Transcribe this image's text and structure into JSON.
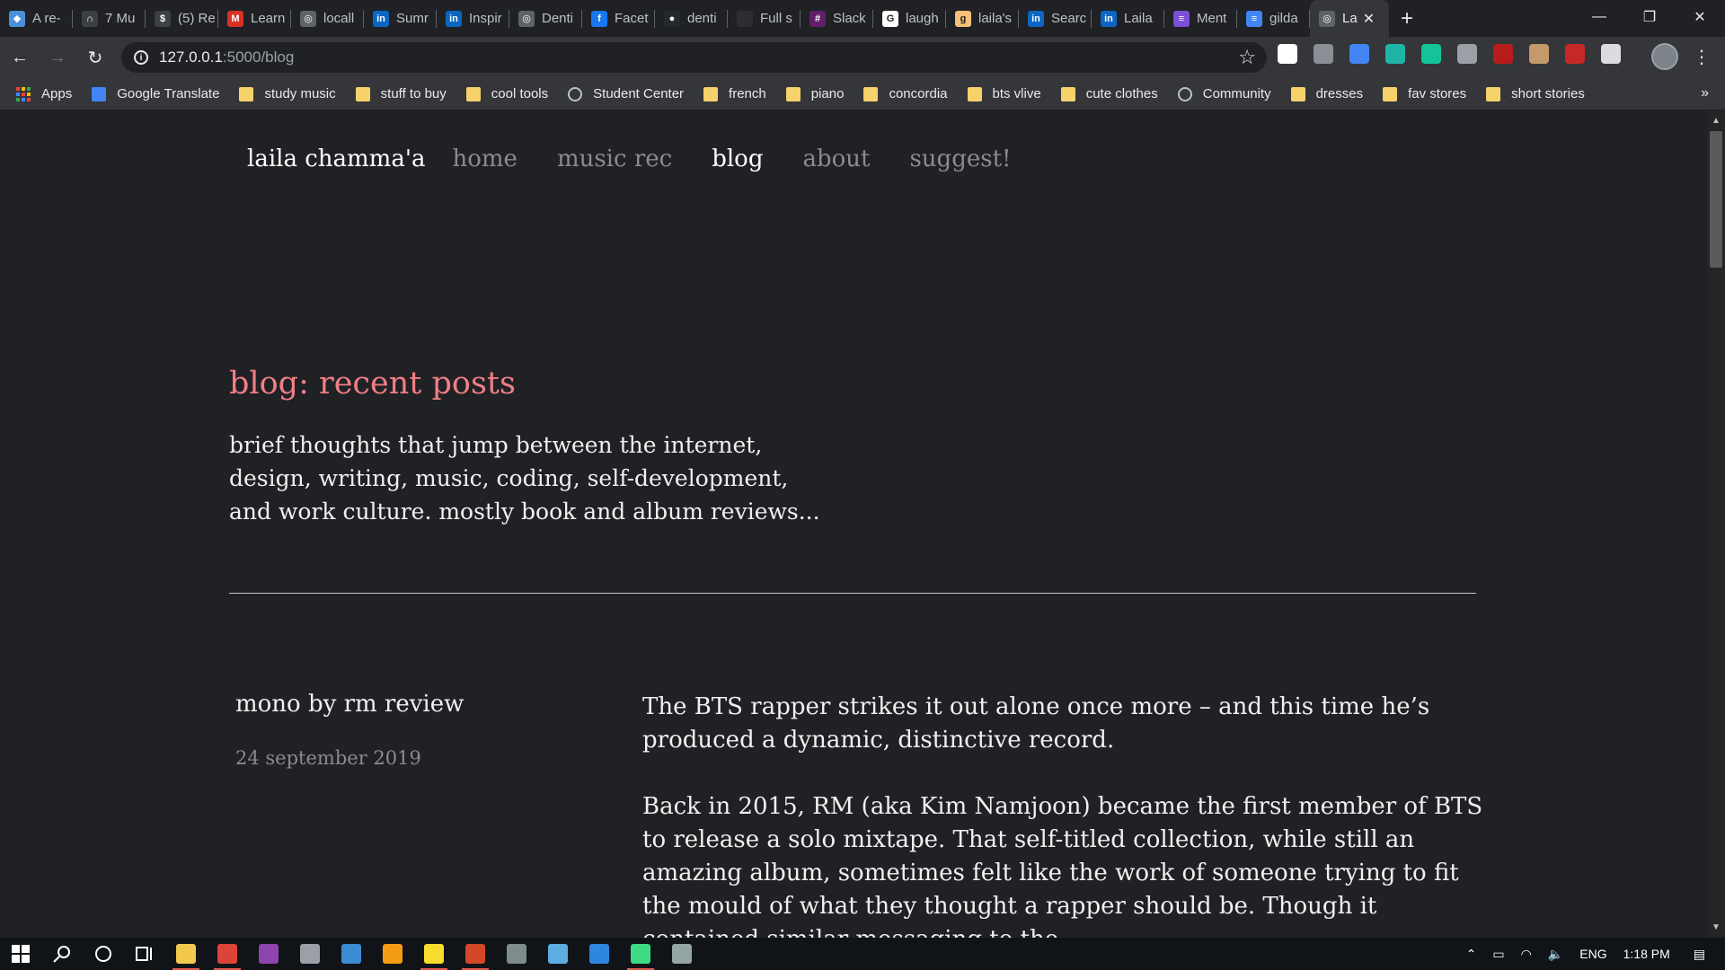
{
  "browser": {
    "tabs": [
      {
        "label": "A re-",
        "fav_color": "#4a90d9",
        "fav_glyph": "◆"
      },
      {
        "label": "7 Mu",
        "fav_color": "#3c4043",
        "fav_glyph": "∩"
      },
      {
        "label": "(5) Re",
        "fav_color": "#3c4043",
        "fav_glyph": "$"
      },
      {
        "label": "Learn",
        "fav_color": "#d93025",
        "fav_glyph": "M"
      },
      {
        "label": "locall",
        "fav_color": "#5f6368",
        "fav_glyph": "◎"
      },
      {
        "label": "Sumr",
        "fav_color": "#0a66c2",
        "fav_glyph": "in"
      },
      {
        "label": "Inspir",
        "fav_color": "#0a66c2",
        "fav_glyph": "in"
      },
      {
        "label": "Denti",
        "fav_color": "#5f6368",
        "fav_glyph": "◎"
      },
      {
        "label": "Facet",
        "fav_color": "#1877f2",
        "fav_glyph": "f"
      },
      {
        "label": "denti",
        "fav_color": "#24292e",
        "fav_glyph": "●"
      },
      {
        "label": "Full s",
        "fav_color": "#2d2e30",
        "fav_glyph": ""
      },
      {
        "label": "Slack",
        "fav_color": "#611f69",
        "fav_glyph": "#"
      },
      {
        "label": "laugh",
        "fav_color": "#ffffff",
        "fav_glyph": "G"
      },
      {
        "label": "laila's",
        "fav_color": "#f6c177",
        "fav_glyph": "g"
      },
      {
        "label": "Searc",
        "fav_color": "#0a66c2",
        "fav_glyph": "in"
      },
      {
        "label": "Laila",
        "fav_color": "#0a66c2",
        "fav_glyph": "in"
      },
      {
        "label": "Ment",
        "fav_color": "#7b4fd6",
        "fav_glyph": "≡"
      },
      {
        "label": "gilda",
        "fav_color": "#4285f4",
        "fav_glyph": "≡"
      }
    ],
    "active_tab": {
      "label": "La",
      "fav_color": "#5f6368",
      "fav_glyph": "◎"
    },
    "url_host": "127.0.0.1",
    "url_path": ":5000/blog",
    "extensions": [
      {
        "name": "block-extension-icon",
        "color": "#ffffff"
      },
      {
        "name": "nx-extension-icon",
        "color": "#8a8f96"
      },
      {
        "name": "translate-extension-icon",
        "color": "#4285f4"
      },
      {
        "name": "m-extension-icon",
        "color": "#1fb5a6"
      },
      {
        "name": "grammarly-extension-icon",
        "color": "#15c39a"
      },
      {
        "name": "puzzle-extension-icon",
        "color": "#9aa0a6"
      },
      {
        "name": "ublock-extension-icon",
        "color": "#b71c1c"
      },
      {
        "name": "gear-extension-icon",
        "color": "#c49a6c"
      },
      {
        "name": "flag-extension-icon",
        "color": "#c62828"
      },
      {
        "name": "circle-extension-icon",
        "color": "#dadce0"
      }
    ],
    "bookmarks": [
      {
        "label": "Apps",
        "type": "apps"
      },
      {
        "label": "Google Translate",
        "type": "translate"
      },
      {
        "label": "study music",
        "type": "folder"
      },
      {
        "label": "stuff to buy",
        "type": "folder"
      },
      {
        "label": "cool tools",
        "type": "folder"
      },
      {
        "label": "Student Center",
        "type": "globe"
      },
      {
        "label": "french",
        "type": "folder"
      },
      {
        "label": "piano",
        "type": "folder"
      },
      {
        "label": "concordia",
        "type": "folder"
      },
      {
        "label": "bts vlive",
        "type": "folder"
      },
      {
        "label": "cute clothes",
        "type": "folder"
      },
      {
        "label": "Community",
        "type": "globe"
      },
      {
        "label": "dresses",
        "type": "folder"
      },
      {
        "label": "fav stores",
        "type": "folder"
      },
      {
        "label": "short stories",
        "type": "folder"
      }
    ],
    "bookmarks_overflow": "»"
  },
  "site": {
    "brand": "laila chamma'a",
    "nav": [
      "home",
      "music rec",
      "blog",
      "about",
      "suggest!"
    ],
    "current_nav": "blog",
    "heading": "blog: recent posts",
    "intro": "brief thoughts that jump between the internet, design, writing, music, coding, self-development, and work culture. mostly book and album reviews...",
    "post": {
      "title": "mono by rm review",
      "date": "24 september 2019",
      "paragraphs": [
        "The BTS rapper strikes it out alone once more – and this time he’s produced a dynamic, distinctive record.",
        "Back in 2015, RM (aka Kim Namjoon) became the first member of BTS to release a solo mixtape. That self-titled collection, while still an amazing album, sometimes felt like the work of someone trying to fit the mould of what they thought a rapper should be. Though it contained similar messaging to the"
      ]
    }
  },
  "taskbar": {
    "apps": [
      {
        "name": "file-explorer-icon",
        "color": "#f2c94c",
        "running": true
      },
      {
        "name": "chrome-icon",
        "color": "#db4437",
        "running": true
      },
      {
        "name": "media-player-icon",
        "color": "#8e44ad",
        "running": false
      },
      {
        "name": "app-icon",
        "color": "#9aa0a6",
        "running": false
      },
      {
        "name": "library-icon",
        "color": "#3d8bd4",
        "running": false
      },
      {
        "name": "sublime-icon",
        "color": "#f39c12",
        "running": false
      },
      {
        "name": "sticky-notes-icon",
        "color": "#f7dc2c",
        "running": true
      },
      {
        "name": "powerpoint-icon",
        "color": "#d24726",
        "running": true
      },
      {
        "name": "network-app-icon",
        "color": "#7f8c8d",
        "running": false
      },
      {
        "name": "notes-app-icon",
        "color": "#5dade2",
        "running": false
      },
      {
        "name": "photos-icon",
        "color": "#2e86de",
        "running": false
      },
      {
        "name": "android-studio-icon",
        "color": "#3ddc84",
        "running": true
      },
      {
        "name": "paint-icon",
        "color": "#95a5a6",
        "running": false
      }
    ],
    "language": "ENG",
    "time": "1:18 PM"
  }
}
